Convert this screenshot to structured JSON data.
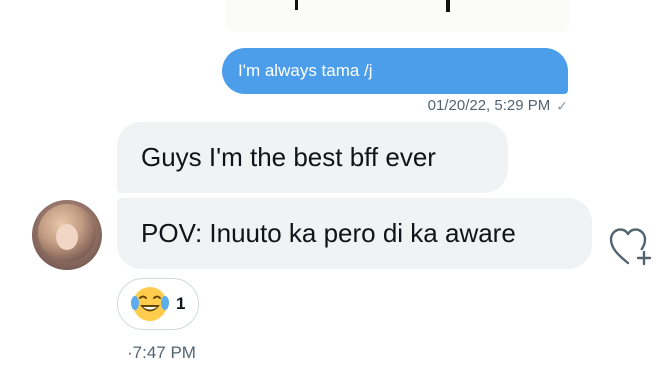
{
  "outgoing_message": {
    "text": "I'm always tama /j",
    "timestamp": "01/20/22, 5:29 PM",
    "status_icon": "sent-check-icon",
    "bubble_color": "#4c9eeb"
  },
  "incoming_messages": [
    {
      "text": "Guys I'm the best bff ever"
    },
    {
      "text": "POV: Inuuto ka pero di ka aware"
    }
  ],
  "incoming_bubble_color": "#eff3f4",
  "reaction": {
    "emoji_icon": "face-with-tears-of-joy-icon",
    "count": "1"
  },
  "react_button_icon": "heart-plus-icon",
  "incoming_time": "·7:47 PM"
}
